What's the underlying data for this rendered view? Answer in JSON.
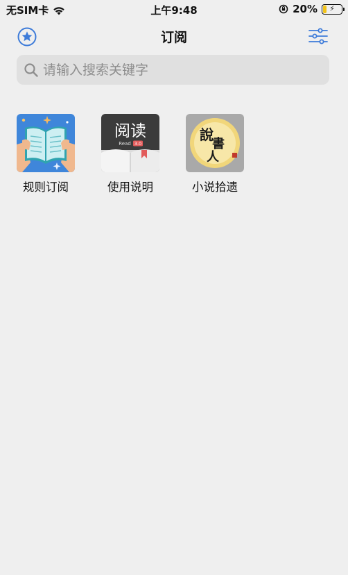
{
  "status_bar": {
    "carrier": "无SIM卡",
    "time": "上午9:48",
    "battery_percent": "20%",
    "battery_level": 0.2,
    "icons": [
      "wifi-icon",
      "orientation-lock-icon",
      "battery-charging-icon"
    ]
  },
  "nav": {
    "title": "订阅",
    "left_icon": "star-circle-icon",
    "right_icon": "sliders-icon",
    "accent_color": "#3d7bd9"
  },
  "search": {
    "placeholder": "请输入搜索关键字",
    "value": ""
  },
  "subscriptions": [
    {
      "label": "规则订阅",
      "icon": "open-book-icon"
    },
    {
      "label": "使用说明",
      "icon": "read-app-icon",
      "icon_text": "阅读",
      "icon_subtext": "Read",
      "icon_badge": "3.0"
    },
    {
      "label": "小说拾遗",
      "icon": "storyteller-icon",
      "icon_text": "說書人"
    }
  ]
}
